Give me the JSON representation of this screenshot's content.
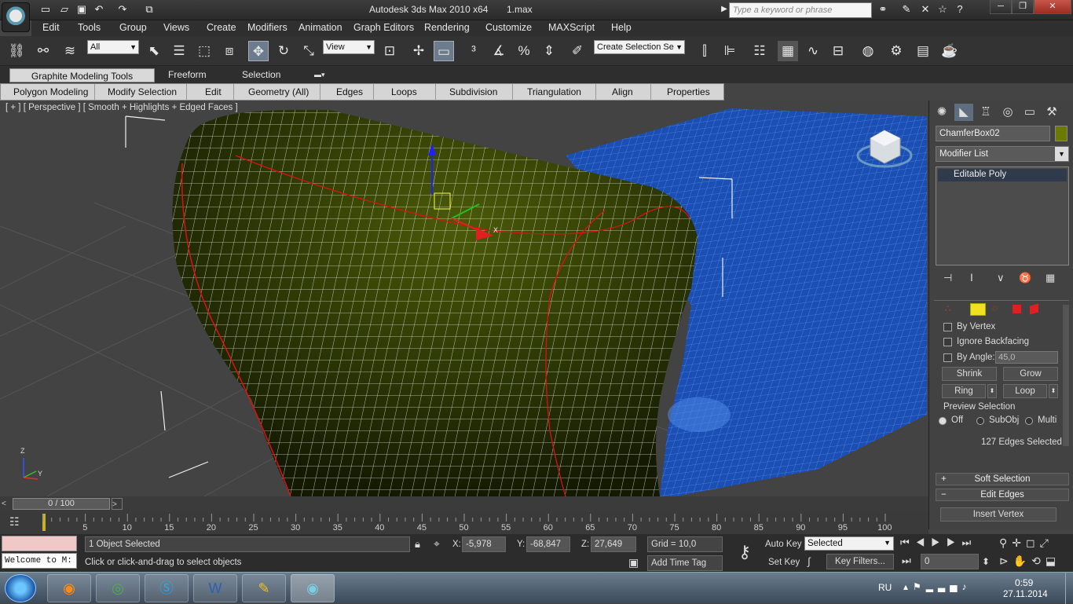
{
  "title": {
    "app": "Autodesk 3ds Max  2010 x64",
    "file": "1.max",
    "search_placeholder": "Type a keyword or phrase"
  },
  "menu": [
    "Edit",
    "Tools",
    "Group",
    "Views",
    "Create",
    "Modifiers",
    "Animation",
    "Graph Editors",
    "Rendering",
    "Customize",
    "MAXScript",
    "Help"
  ],
  "toolbar": {
    "filter": "All",
    "ref_coord": "View",
    "selection_set": "Create Selection Se"
  },
  "ribbon_tabs": [
    "Graphite Modeling Tools",
    "Freeform",
    "Selection"
  ],
  "ribbon_panels": [
    "Polygon Modeling",
    "Modify Selection",
    "Edit",
    "Geometry (All)",
    "Edges",
    "Loops",
    "Subdivision",
    "Triangulation",
    "Align",
    "Properties"
  ],
  "viewport": {
    "label": "[ + ] [ Perspective ] [ Smooth + Highlights + Edged Faces ]",
    "axis_x": "X",
    "axis_y": "Y",
    "axis_z": "Z"
  },
  "command_panel": {
    "object_name": "ChamferBox02",
    "object_color": "#6b7a00",
    "modifier_list": "Modifier List",
    "stack_item": "Editable Poly",
    "by_vertex": "By Vertex",
    "ignore_backfacing": "Ignore Backfacing",
    "by_angle": "By Angle:",
    "angle_value": "45,0",
    "shrink": "Shrink",
    "grow": "Grow",
    "ring": "Ring",
    "loop": "Loop",
    "preview_selection": "Preview Selection",
    "preview_off": "Off",
    "preview_subobj": "SubObj",
    "preview_multi": "Multi",
    "edges_selected": "127 Edges Selected",
    "soft_selection": "Soft Selection",
    "edit_edges": "Edit Edges",
    "insert_vertex": "Insert Vertex"
  },
  "timeline": {
    "frame": "0 / 100",
    "ticks": [
      "5",
      "10",
      "15",
      "20",
      "25",
      "30",
      "35",
      "40",
      "45",
      "50",
      "55",
      "60",
      "65",
      "70",
      "75",
      "80",
      "85",
      "90",
      "95",
      "100"
    ]
  },
  "status": {
    "listener": "Welcome to M:",
    "selected": "1 Object Selected",
    "prompt": "Click or click-and-drag to select objects",
    "x_label": "X:",
    "x": "-5,978",
    "y_label": "Y:",
    "y": "-68,847",
    "z_label": "Z:",
    "z": "27,649",
    "grid": "Grid = 10,0",
    "add_time_tag": "Add Time Tag",
    "auto_key": "Auto Key",
    "set_key": "Set Key",
    "key_mode": "Selected",
    "key_filters": "Key Filters...",
    "current_frame": "0"
  },
  "taskbar": {
    "lang": "RU",
    "time": "0:59",
    "date": "27.11.2014"
  }
}
